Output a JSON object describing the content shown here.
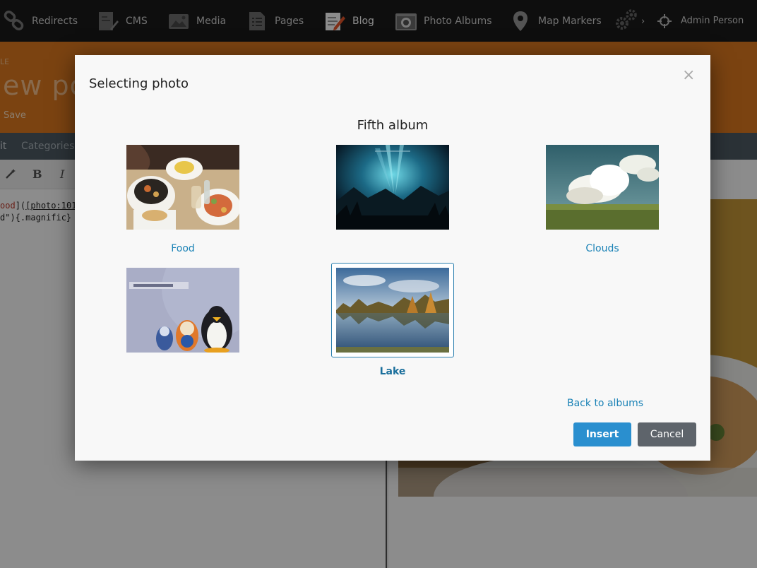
{
  "nav": {
    "items": [
      {
        "label": "Redirects",
        "icon": "link-icon"
      },
      {
        "label": "CMS",
        "icon": "cms-icon"
      },
      {
        "label": "Media",
        "icon": "media-icon"
      },
      {
        "label": "Pages",
        "icon": "pages-icon"
      },
      {
        "label": "Blog",
        "icon": "blog-icon",
        "active": true
      },
      {
        "label": "Photo Albums",
        "icon": "camera-icon"
      },
      {
        "label": "Map Markers",
        "icon": "map-marker-icon"
      }
    ],
    "more_label": "›",
    "user_name": "Admin Person"
  },
  "page": {
    "kicker": "LE",
    "title": "ew po",
    "save_label": "Save",
    "tabs": {
      "edit": "it",
      "categories": "Categories"
    },
    "toolbar": {
      "bold": "B",
      "italic": "I"
    },
    "code": {
      "line1_a": "ood",
      "line1_b": "](",
      "line1_c": "[photo:101",
      "line2": "d\"){.magnific}"
    }
  },
  "modal": {
    "title": "Selecting photo",
    "close_label": "×",
    "album_title": "Fifth album",
    "photos": [
      {
        "label": "Food",
        "selected": false
      },
      {
        "label": "",
        "selected": false
      },
      {
        "label": "Clouds",
        "selected": false
      },
      {
        "label": "",
        "selected": false
      },
      {
        "label": "Lake",
        "selected": true
      }
    ],
    "back_label": "Back to albums",
    "insert_label": "Insert",
    "cancel_label": "Cancel"
  },
  "colors": {
    "nav_bg": "#1b1b1b",
    "header_orange": "#e07a1f",
    "link_blue": "#1a82b6",
    "insert_blue": "#2a8fcf",
    "cancel_gray": "#5e646b"
  }
}
